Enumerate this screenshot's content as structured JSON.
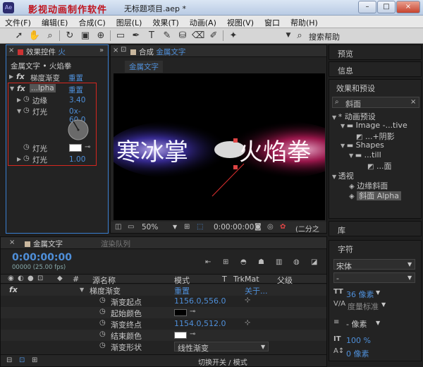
{
  "watermark": "影视动画制作软件",
  "window": {
    "title": "无标题项目.aep *",
    "min": "–",
    "max": "□",
    "close": "×"
  },
  "menu": [
    "文件(F)",
    "编辑(E)",
    "合成(C)",
    "图层(L)",
    "效果(T)",
    "动画(A)",
    "视图(V)",
    "窗口",
    "帮助(H)"
  ],
  "toolbar": {
    "search_label": "搜索帮助",
    "search_icon": "⌕"
  },
  "effects_panel": {
    "tab": "效果控件",
    "tab_suffix": "火",
    "subtitle": "金属文字 • 火焰拳",
    "fx": [
      {
        "name": "梯度渐变",
        "reset": "重置"
      },
      {
        "name": "...lpha",
        "reset": "重置"
      }
    ],
    "params": [
      {
        "name": "边缘",
        "value": "3.40"
      },
      {
        "name": "灯光",
        "value": "0x-60.0"
      },
      {
        "name": "灯光",
        "value": ""
      },
      {
        "name": "灯光",
        "value": "1.00"
      }
    ]
  },
  "comp_panel": {
    "tab_prefix": "合成",
    "tab": "金属文字",
    "crumb": "金属文字",
    "text_left": "寒冰掌",
    "text_right": "火焰拳",
    "zoom": "50%",
    "timecode": "0:00:00:00",
    "extra": "(二分之"
  },
  "right_panels": {
    "preview": "预览",
    "info": "信息",
    "effects_presets": "效果和预设",
    "search": "斜面",
    "tree": [
      {
        "label": "* 动画预设",
        "level": 0
      },
      {
        "label": "Image -...tive",
        "level": 1
      },
      {
        "label": "...+阴影",
        "level": 2
      },
      {
        "label": "Shapes",
        "level": 1
      },
      {
        "label": "...till",
        "level": 2
      },
      {
        "label": "...面",
        "level": 3
      },
      {
        "label": "透视",
        "level": 0
      },
      {
        "label": "边缘斜面",
        "level": 1
      },
      {
        "label": "斜面 Alpha",
        "level": 1
      }
    ],
    "library": "库",
    "character": "字符",
    "font": "宋体",
    "font_style": "-",
    "font_size": "36 像素",
    "tracking_label": "度量标准",
    "leading": "- 像素",
    "scale": "100 %",
    "baseline": "0 像素"
  },
  "timeline": {
    "tab": "金属文字",
    "render_tab": "渲染队列",
    "timecode": "0:00:00:00",
    "fps": "00000 (25.00 fps)",
    "col_num": "#",
    "col_source": "源名称",
    "col_mode": "模式",
    "col_t": "T",
    "col_trkmat": "TrkMat",
    "col_parent": "父级",
    "rows": [
      {
        "fx": "fx",
        "name": "梯度渐变",
        "value": "重置",
        "extra": "关于..."
      },
      {
        "name": "渐变起点",
        "value": "1156.0,556.0"
      },
      {
        "name": "起始颜色",
        "value": ""
      },
      {
        "name": "渐变终点",
        "value": "1154.0,512.0"
      },
      {
        "name": "结束颜色",
        "value": ""
      },
      {
        "name": "渐变形状",
        "value": "线性渐变"
      }
    ],
    "footer": "切换开关 / 模式"
  },
  "colors": {
    "accent": "#4f8fd9",
    "highlight": "#d4271f"
  }
}
